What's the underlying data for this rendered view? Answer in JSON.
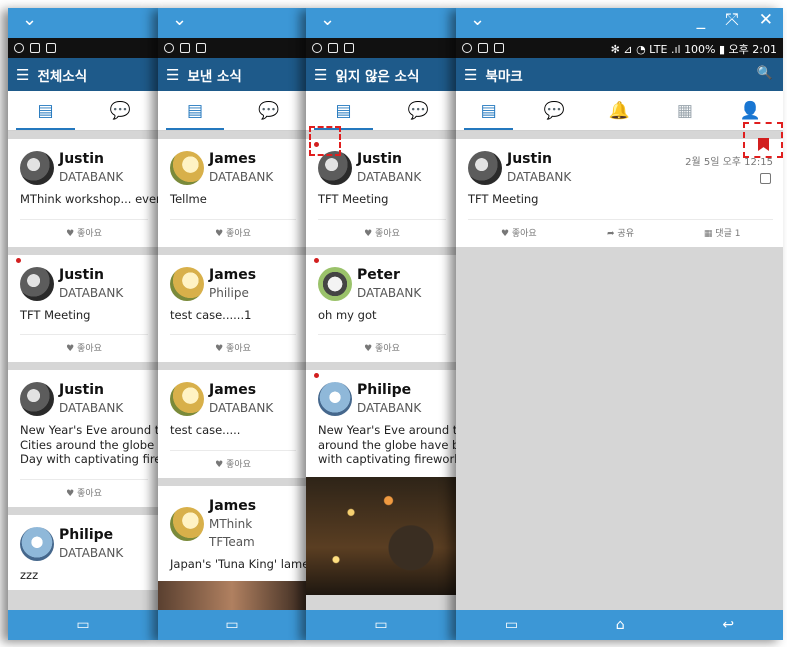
{
  "common": {
    "chevron": "⌄",
    "menu_icon": "☰",
    "status_left": [
      "U",
      "◉",
      "A"
    ],
    "like": "♥ 좋아요",
    "share": "➦ 공유",
    "comment": "▦ 댓글 1",
    "nav_recent": "▭",
    "nav_home": "⌂",
    "nav_back": "↩"
  },
  "screen1": {
    "title": "전체소식",
    "cards": [
      {
        "name": "Justin",
        "org": "DATABANK",
        "text": "MThink workshop... every"
      },
      {
        "name": "Justin",
        "org": "DATABANK",
        "text": "TFT Meeting"
      },
      {
        "name": "Justin",
        "org": "DATABANK",
        "text1": "New Year's Eve around th",
        "text2": "Cities around the globe h",
        "text3": "Day with captivating firew"
      },
      {
        "name": "Philipe",
        "org": "DATABANK",
        "text": "zzz"
      }
    ]
  },
  "screen2": {
    "title": "보낸 소식",
    "cards": [
      {
        "name": "James",
        "org": "DATABANK",
        "text": "Tellme"
      },
      {
        "name": "James",
        "org": "Philipe",
        "text": "test case......1"
      },
      {
        "name": "James",
        "org": "DATABANK",
        "text": "test case....."
      },
      {
        "name": "James",
        "org": "MThink TFTeam",
        "text": "Japan's 'Tuna King' lame"
      }
    ]
  },
  "screen3": {
    "title": "읽지 않은 소식",
    "cards": [
      {
        "name": "Justin",
        "org": "DATABANK",
        "text": "TFT Meeting"
      },
      {
        "name": "Peter",
        "org": "DATABANK",
        "text": "oh my got"
      },
      {
        "name": "Philipe",
        "org": "DATABANK",
        "text1": "New Year's Eve around th",
        "text2": "around the globe have be",
        "text3": "with captivating fireworks"
      }
    ]
  },
  "screen4": {
    "title": "북마크",
    "window_controls": [
      "_",
      "⤧",
      "✕"
    ],
    "status_right": "✻ ⊿ ◔ LTE .ıl 100% ▮ 오후 2:01",
    "card": {
      "name": "Justin",
      "org": "DATABANK",
      "text": "TFT Meeting",
      "time": "2월 5일 오후 12:15"
    }
  }
}
